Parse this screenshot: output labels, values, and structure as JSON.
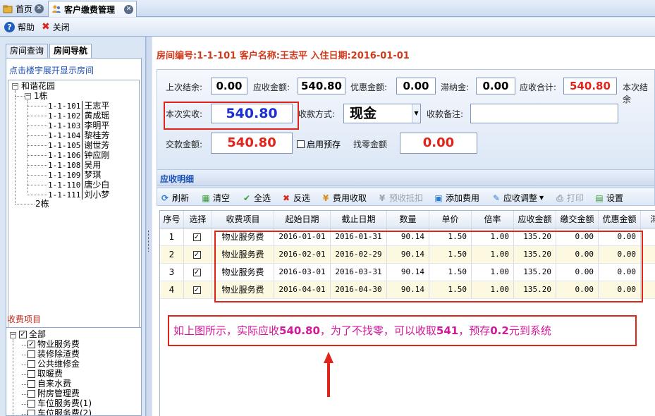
{
  "tabs": [
    {
      "label": "首页"
    },
    {
      "label": "客户缴费管理"
    }
  ],
  "toolbar": {
    "help": "帮助",
    "close": "关闭"
  },
  "left": {
    "tabs": [
      "房间查询",
      "房间导航"
    ],
    "hint": "点击楼宇展开显示房间",
    "tree": {
      "root": "和谐花园",
      "building1": "1栋",
      "rooms": [
        {
          "code": "1-1-101",
          "name": "王志平"
        },
        {
          "code": "1-1-102",
          "name": "黄成瑶"
        },
        {
          "code": "1-1-103",
          "name": "李明平"
        },
        {
          "code": "1-1-104",
          "name": "黎桂芳"
        },
        {
          "code": "1-1-105",
          "name": "谢世芳"
        },
        {
          "code": "1-1-106",
          "name": "钟应刚"
        },
        {
          "code": "1-1-108",
          "name": "吴用"
        },
        {
          "code": "1-1-109",
          "name": "梦琪"
        },
        {
          "code": "1-1-110",
          "name": "唐少白"
        },
        {
          "code": "1-1-111",
          "name": "刘小梦"
        }
      ],
      "building2": "2栋"
    },
    "fee_title": "收费项目",
    "fee_items": [
      {
        "label": "全部",
        "checked": "✓"
      },
      {
        "label": "物业服务费",
        "checked": "✓"
      },
      {
        "label": "装修除渣费",
        "checked": ""
      },
      {
        "label": "公共维修金",
        "checked": ""
      },
      {
        "label": "取暖费",
        "checked": ""
      },
      {
        "label": "自来水费",
        "checked": ""
      },
      {
        "label": "附房管理费",
        "checked": ""
      },
      {
        "label": "车位服务费(1)",
        "checked": ""
      },
      {
        "label": "车位服务费(2)",
        "checked": ""
      }
    ]
  },
  "main": {
    "info": "房间编号:1-1-101 客户名称:王志平 入住日期:2016-01-01",
    "form": {
      "last_balance_label": "上次结余:",
      "last_balance": "0.00",
      "receivable_label": "应收金额:",
      "receivable": "540.80",
      "discount_label": "优惠金额:",
      "discount": "0.00",
      "late_fee_label": "滞纳金:",
      "late_fee": "0.00",
      "total_label": "应收合计:",
      "total": "540.80",
      "this_balance_label": "本次结余",
      "actual_label": "本次实收:",
      "actual": "540.80",
      "method_label": "收款方式:",
      "method": "现金",
      "remark_label": "收款备注:",
      "remark": "",
      "paid_label": "交款金额:",
      "paid": "540.80",
      "prepay_label": "启用预存",
      "change_label": "找零金额",
      "change": "0.00"
    },
    "detail_title": "应收明细",
    "detail_toolbar": [
      "刷新",
      "清空",
      "全选",
      "反选",
      "费用收取",
      "预收抵扣",
      "添加费用",
      "应收调整",
      "打印",
      "设置"
    ],
    "grid": {
      "columns": [
        "序号",
        "选择",
        "收费项目",
        "起始日期",
        "截止日期",
        "数量",
        "单价",
        "倍率",
        "应收金额",
        "缴交金额",
        "优惠金额",
        "滞"
      ],
      "rows": [
        {
          "no": "1",
          "check": "✓",
          "item": "物业服务费",
          "start": "2016-01-01",
          "end": "2016-01-31",
          "qty": "90.14",
          "price": "1.50",
          "rate": "1.00",
          "amount": "135.20",
          "paid": "0.00",
          "discount": "0.00"
        },
        {
          "no": "2",
          "check": "✓",
          "item": "物业服务费",
          "start": "2016-02-01",
          "end": "2016-02-29",
          "qty": "90.14",
          "price": "1.50",
          "rate": "1.00",
          "amount": "135.20",
          "paid": "0.00",
          "discount": "0.00"
        },
        {
          "no": "3",
          "check": "✓",
          "item": "物业服务费",
          "start": "2016-03-01",
          "end": "2016-03-31",
          "qty": "90.14",
          "price": "1.50",
          "rate": "1.00",
          "amount": "135.20",
          "paid": "0.00",
          "discount": "0.00"
        },
        {
          "no": "4",
          "check": "✓",
          "item": "物业服务费",
          "start": "2016-04-01",
          "end": "2016-04-30",
          "qty": "90.14",
          "price": "1.50",
          "rate": "1.00",
          "amount": "135.20",
          "paid": "0.00",
          "discount": "0.00"
        }
      ]
    },
    "note": {
      "p1": "如上图所示，实际应收",
      "v1": "540.80",
      "p2": "，为了不找零，可以收取",
      "v2": "541",
      "p3": "，预存",
      "v3": "0.2",
      "p4": "元到系统"
    }
  },
  "colors": {
    "accent_red": "#e0241a",
    "accent_blue": "#1a2fd6",
    "note_magenta": "#d4189a"
  }
}
